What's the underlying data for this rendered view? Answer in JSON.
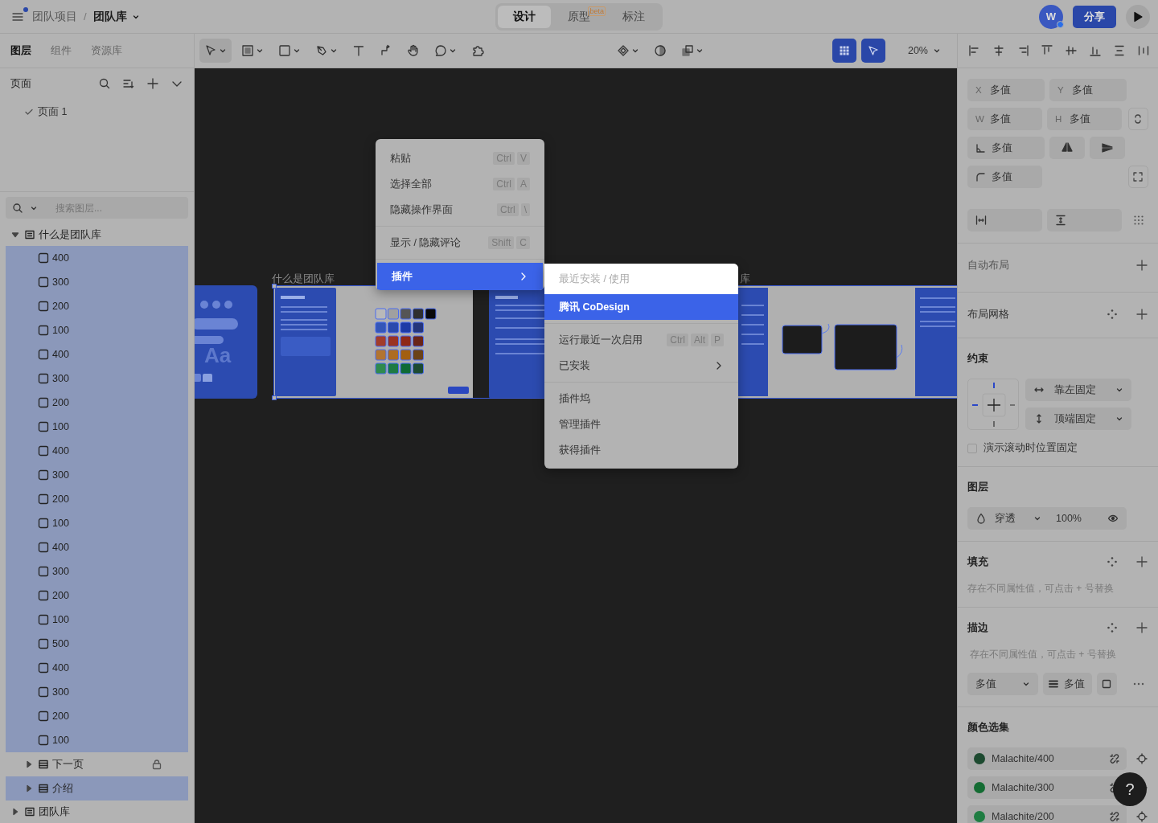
{
  "topbar": {
    "breadcrumb": {
      "parent": "团队项目",
      "separator": "/",
      "current": "团队库"
    },
    "modes": [
      {
        "label": "设计",
        "selected": true
      },
      {
        "label": "原型",
        "selected": false,
        "badge": "beta"
      },
      {
        "label": "标注",
        "selected": false
      }
    ],
    "avatar": "W",
    "share": "分享"
  },
  "left_tabs": [
    {
      "label": "图层",
      "selected": true
    },
    {
      "label": "组件",
      "selected": false
    },
    {
      "label": "资源库",
      "selected": false
    }
  ],
  "pages": {
    "title": "页面",
    "items": [
      {
        "label": "页面 1",
        "selected": true
      }
    ]
  },
  "layer_search": {
    "placeholder": "搜索图层..."
  },
  "layers": [
    {
      "name": "什么是团队库",
      "kind": "frame",
      "expanded": true,
      "selected": false,
      "children": [
        {
          "name": "400",
          "kind": "rect",
          "selected": true
        },
        {
          "name": "300",
          "kind": "rect",
          "selected": true
        },
        {
          "name": "200",
          "kind": "rect",
          "selected": true
        },
        {
          "name": "100",
          "kind": "rect",
          "selected": true
        },
        {
          "name": "400",
          "kind": "rect",
          "selected": true
        },
        {
          "name": "300",
          "kind": "rect",
          "selected": true
        },
        {
          "name": "200",
          "kind": "rect",
          "selected": true
        },
        {
          "name": "100",
          "kind": "rect",
          "selected": true
        },
        {
          "name": "400",
          "kind": "rect",
          "selected": true
        },
        {
          "name": "300",
          "kind": "rect",
          "selected": true
        },
        {
          "name": "200",
          "kind": "rect",
          "selected": true
        },
        {
          "name": "100",
          "kind": "rect",
          "selected": true
        },
        {
          "name": "400",
          "kind": "rect",
          "selected": true
        },
        {
          "name": "300",
          "kind": "rect",
          "selected": true
        },
        {
          "name": "200",
          "kind": "rect",
          "selected": true
        },
        {
          "name": "100",
          "kind": "rect",
          "selected": true
        },
        {
          "name": "500",
          "kind": "rect",
          "selected": true
        },
        {
          "name": "400",
          "kind": "rect",
          "selected": true
        },
        {
          "name": "300",
          "kind": "rect",
          "selected": true
        },
        {
          "name": "200",
          "kind": "rect",
          "selected": true
        },
        {
          "name": "100",
          "kind": "rect",
          "selected": true
        },
        {
          "name": "下一页",
          "kind": "group",
          "expanded": false,
          "selected": false,
          "locked": true
        },
        {
          "name": "介绍",
          "kind": "group",
          "expanded": false,
          "selected": true,
          "locked": false
        }
      ]
    },
    {
      "name": "团队库",
      "kind": "frame",
      "expanded": false,
      "selected": false
    }
  ],
  "toolbar": {
    "zoom": "20%"
  },
  "canvas": {
    "labels": [
      "什么是团队库",
      "库"
    ],
    "cover_text": "Aa"
  },
  "context_menu": {
    "items": [
      {
        "kind": "item",
        "label": "粘贴",
        "keys": [
          "Ctrl",
          "V"
        ],
        "selected": false
      },
      {
        "kind": "item",
        "label": "选择全部",
        "keys": [
          "Ctrl",
          "A"
        ],
        "selected": false
      },
      {
        "kind": "item",
        "label": "隐藏操作界面",
        "keys": [
          "Ctrl",
          "\\"
        ],
        "selected": false
      },
      {
        "kind": "separator"
      },
      {
        "kind": "item",
        "label": "显示 / 隐藏评论",
        "keys": [
          "Shift",
          "C"
        ],
        "selected": false
      },
      {
        "kind": "separator"
      },
      {
        "kind": "submenu",
        "label": "插件",
        "selected": true
      }
    ]
  },
  "submenu": {
    "items": [
      {
        "kind": "header",
        "label": "最近安装 / 使用"
      },
      {
        "kind": "item",
        "label": "腾讯 CoDesign",
        "selected": true
      },
      {
        "kind": "separator"
      },
      {
        "kind": "item",
        "label": "运行最近一次启用",
        "keys": [
          "Ctrl",
          "Alt",
          "P"
        ],
        "selected": false
      },
      {
        "kind": "submenu",
        "label": "已安装",
        "selected": false
      },
      {
        "kind": "separator"
      },
      {
        "kind": "item",
        "label": "插件坞",
        "selected": false
      },
      {
        "kind": "item",
        "label": "管理插件",
        "selected": false
      },
      {
        "kind": "item",
        "label": "获得插件",
        "selected": false
      }
    ]
  },
  "design": {
    "fields": [
      {
        "prefix": "X",
        "value": "多值"
      },
      {
        "prefix": "Y",
        "value": "多值"
      },
      {
        "prefix": "W",
        "value": "多值"
      },
      {
        "prefix": "H",
        "value": "多值"
      }
    ],
    "rotation": "多值",
    "radius": "多值",
    "auto_layout": {
      "title": "自动布局"
    },
    "layout_grid": {
      "title": "布局网格"
    },
    "constraints": {
      "title": "约束",
      "horizontal": "靠左固定",
      "vertical": "顶端固定",
      "fixed_on_scroll": {
        "label": "演示滚动时位置固定",
        "checked": false
      }
    },
    "layer": {
      "title": "图层",
      "blend": "穿透",
      "opacity": "100%"
    },
    "fill": {
      "title": "填充",
      "hint": "存在不同属性值，可点击 + 号替换"
    },
    "stroke": {
      "title": "描边",
      "hint": "存在不同属性值，可点击 + 号替换",
      "position": "多值",
      "weight": "多值"
    },
    "color_styles": {
      "title": "颜色选集",
      "items": [
        {
          "name": "Malachite/400",
          "color": "#1d4a30"
        },
        {
          "name": "Malachite/300",
          "color": "#146c33"
        },
        {
          "name": "Malachite/200",
          "color": "#1f7d42"
        }
      ]
    }
  },
  "help": "?"
}
